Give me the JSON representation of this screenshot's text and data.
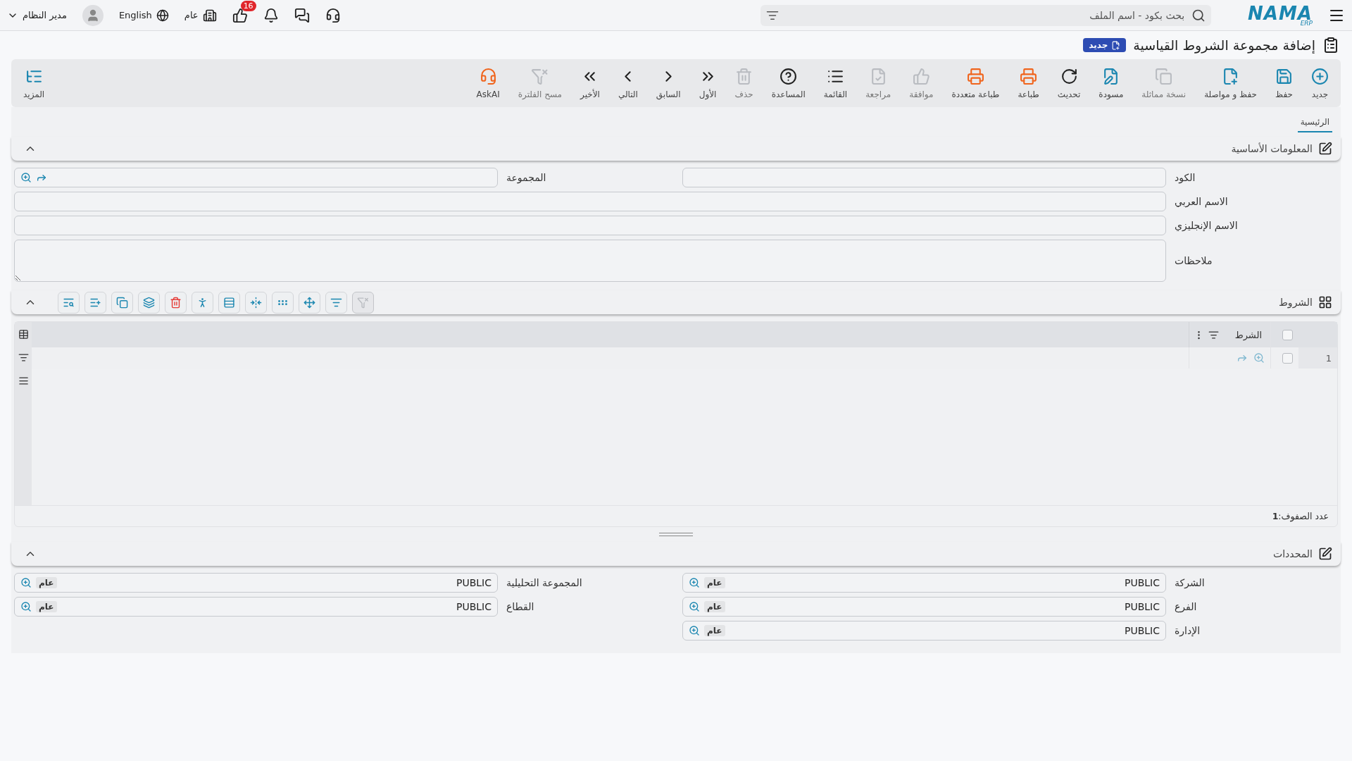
{
  "topbar": {
    "logo": "NAMA",
    "logo_sub": "ERP",
    "search": {
      "placeholder": "بحث بكود - اسم الملف"
    },
    "notifications_badge": "16",
    "company": "عام",
    "language": "English",
    "user": "مدير النظام"
  },
  "page": {
    "title": "إضافة مجموعة الشروط القياسية",
    "badge": "جديد"
  },
  "toolbar": [
    {
      "kind": "new",
      "label": "جديد",
      "disabled": false
    },
    {
      "kind": "save",
      "label": "حفظ",
      "disabled": false
    },
    {
      "kind": "save_continue",
      "label": "حفظ و مواصلة",
      "disabled": false
    },
    {
      "kind": "duplicate",
      "label": "نسخة مماثلة",
      "disabled": true
    },
    {
      "kind": "draft",
      "label": "مسودة",
      "disabled": false
    },
    {
      "kind": "refresh",
      "label": "تحديث",
      "disabled": false
    },
    {
      "kind": "print",
      "label": "طباعة",
      "disabled": false
    },
    {
      "kind": "multi_print",
      "label": "طباعة متعددة",
      "disabled": false
    },
    {
      "kind": "approve",
      "label": "موافقة",
      "disabled": true
    },
    {
      "kind": "review",
      "label": "مراجعة",
      "disabled": true
    },
    {
      "kind": "list",
      "label": "القائمة",
      "disabled": false
    },
    {
      "kind": "help",
      "label": "المساعدة",
      "disabled": false
    },
    {
      "kind": "delete",
      "label": "حذف",
      "disabled": true
    },
    {
      "kind": "first",
      "label": "الأول",
      "disabled": false
    },
    {
      "kind": "previous",
      "label": "السابق",
      "disabled": false
    },
    {
      "kind": "next",
      "label": "التالي",
      "disabled": false
    },
    {
      "kind": "last",
      "label": "الأخير",
      "disabled": false
    },
    {
      "kind": "clear_filter",
      "label": "مسح الفلترة",
      "disabled": true
    },
    {
      "kind": "ask_ai",
      "label": "AskAI",
      "disabled": false
    }
  ],
  "more": {
    "label": "المزيد"
  },
  "tabs": [
    {
      "label": "الرئيسية",
      "selected": true
    }
  ],
  "basic_section": {
    "title": "المعلومات الأساسية",
    "expanded": true,
    "rows": [
      [
        {
          "label": "الكود",
          "kind": "text"
        },
        {
          "label": "المجموعة",
          "kind": "lookup"
        }
      ],
      [
        {
          "label": "الاسم العربي",
          "kind": "text"
        }
      ],
      [
        {
          "label": "الاسم الإنجليزي",
          "kind": "text"
        }
      ],
      [
        {
          "label": "ملاحظات",
          "kind": "textarea"
        }
      ]
    ]
  },
  "conditions": {
    "title": "الشروط",
    "expanded": true,
    "tools": [
      {
        "kind": "clear_filter",
        "disabled": true
      },
      {
        "kind": "filter",
        "disabled": false
      },
      {
        "kind": "move",
        "disabled": false
      },
      {
        "kind": "dots",
        "disabled": false
      },
      {
        "kind": "fit_columns",
        "disabled": false
      },
      {
        "kind": "rows",
        "disabled": false
      },
      {
        "kind": "run",
        "disabled": false
      },
      {
        "kind": "delete",
        "disabled": false
      },
      {
        "kind": "layers",
        "disabled": false
      },
      {
        "kind": "copy",
        "disabled": false
      },
      {
        "kind": "add_row",
        "disabled": false
      },
      {
        "kind": "search_list",
        "disabled": false
      }
    ],
    "all_checked": false,
    "columns": [
      {
        "label": "الشرط"
      }
    ],
    "rows": [
      {
        "number": "1",
        "checked": false
      }
    ],
    "footer": "عدد الصفوف:**1**"
  },
  "limits_section": {
    "title": "المحددات",
    "expanded": true,
    "rows": [
      [
        {
          "label": "الشركة",
          "value": "PUBLIC",
          "tag": "عام"
        },
        {
          "label": "المجموعة التحليلية",
          "value": "PUBLIC",
          "tag": "عام"
        }
      ],
      [
        {
          "label": "الفرع",
          "value": "PUBLIC",
          "tag": "عام"
        },
        {
          "label": "القطاع",
          "value": "PUBLIC",
          "tag": "عام"
        }
      ],
      [
        {
          "label": "الإدارة",
          "value": "PUBLIC",
          "tag": "عام"
        }
      ]
    ]
  }
}
